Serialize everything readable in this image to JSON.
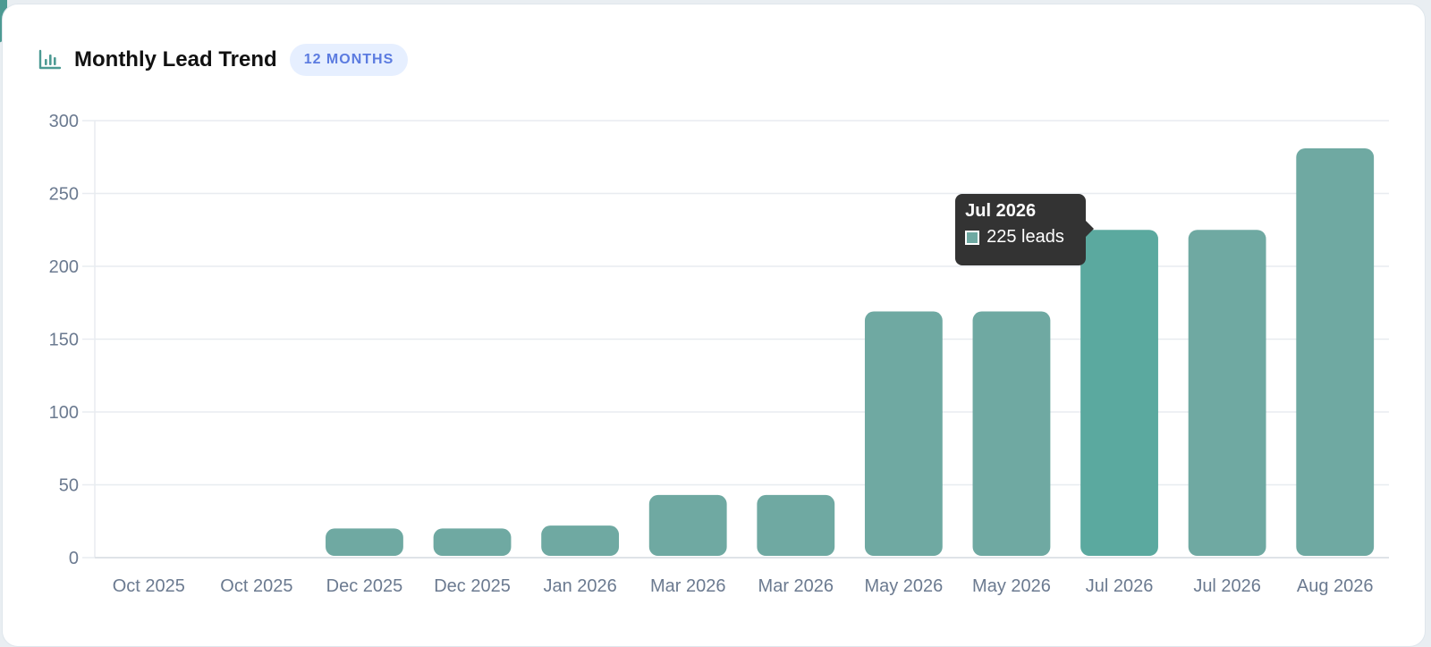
{
  "header": {
    "title": "Monthly Lead Trend",
    "badge": "12 MONTHS",
    "icon": "bar-chart-icon"
  },
  "colors": {
    "bar": "#6fa9a2",
    "bar_active": "#5ba99f",
    "accent": "#4c9a93",
    "grid": "#e8ecf0",
    "tick_label": "#6b7a90",
    "badge_bg": "#e6efff",
    "badge_text": "#5b7be0"
  },
  "chart_data": {
    "type": "bar",
    "categories": [
      "Oct 2025",
      "Oct 2025",
      "Dec 2025",
      "Dec 2025",
      "Jan 2026",
      "Mar 2026",
      "Mar 2026",
      "May 2026",
      "May 2026",
      "Jul 2026",
      "Jul 2026",
      "Aug 2026"
    ],
    "values": [
      0,
      0,
      20,
      20,
      22,
      43,
      43,
      169,
      169,
      225,
      225,
      281
    ],
    "ylim": [
      0,
      300
    ],
    "yticks": [
      0,
      50,
      100,
      150,
      200,
      250,
      300
    ],
    "grid": true,
    "active_index": 9
  },
  "tooltip": {
    "title": "Jul 2026",
    "label": "225 leads"
  }
}
